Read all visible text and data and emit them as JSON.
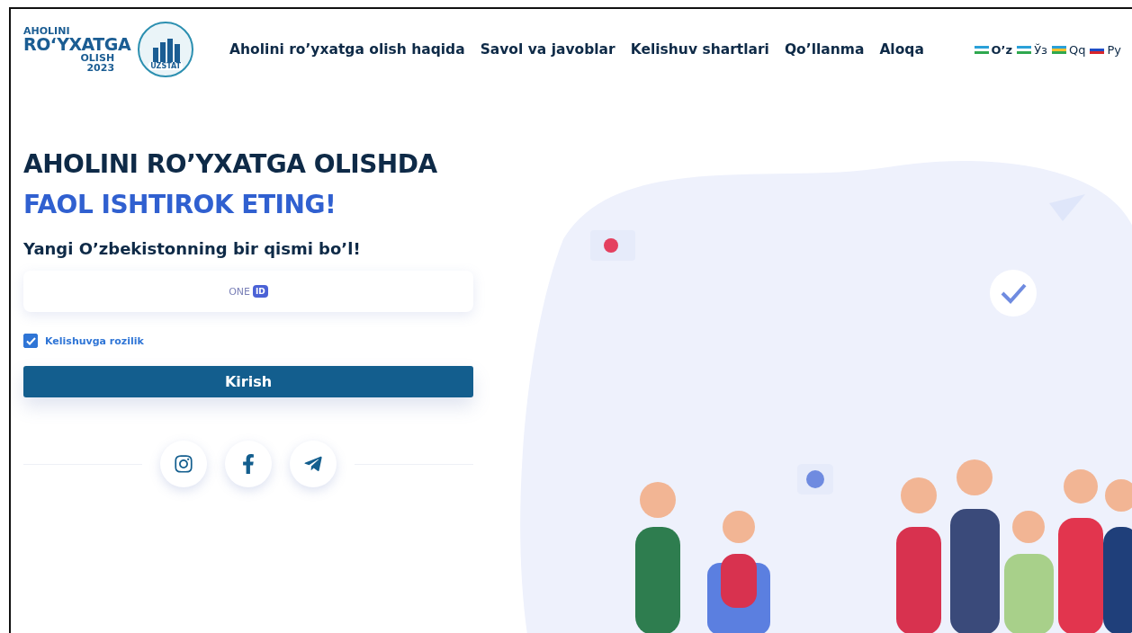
{
  "logo": {
    "line_1": "AHOLINI",
    "line_2": "RO‘YXATGA",
    "line_3": "OLISH",
    "year": "2023",
    "badge": "UZSTAT"
  },
  "nav": [
    "Aholini ro’yxatga olish haqida",
    "Savol va javoblar",
    "Kelishuv shartlari",
    "Qo’llanma",
    "Aloqa"
  ],
  "languages": [
    {
      "label": "O’z",
      "kind": "uz",
      "selected": true
    },
    {
      "label": "Ўз",
      "kind": "uz",
      "selected": false
    },
    {
      "label": "Qq",
      "kind": "kk",
      "selected": false
    },
    {
      "label": "Ру",
      "kind": "ru",
      "selected": false
    }
  ],
  "hero": {
    "title": "AHOLINI RO’YXATGA OLISHDA",
    "title_accent": "FAOL ISHTIROK ETING!",
    "subtitle": "Yangi O’zbekistonning bir qismi bo’l!"
  },
  "login": {
    "provider": "ONE",
    "provider_badge": "ID",
    "consent": {
      "label": "Kelishuvga rozilik",
      "checked": true
    },
    "submit": "Kirish"
  },
  "social": [
    {
      "kind": "instagram"
    },
    {
      "kind": "facebook"
    },
    {
      "kind": "telegram"
    }
  ]
}
